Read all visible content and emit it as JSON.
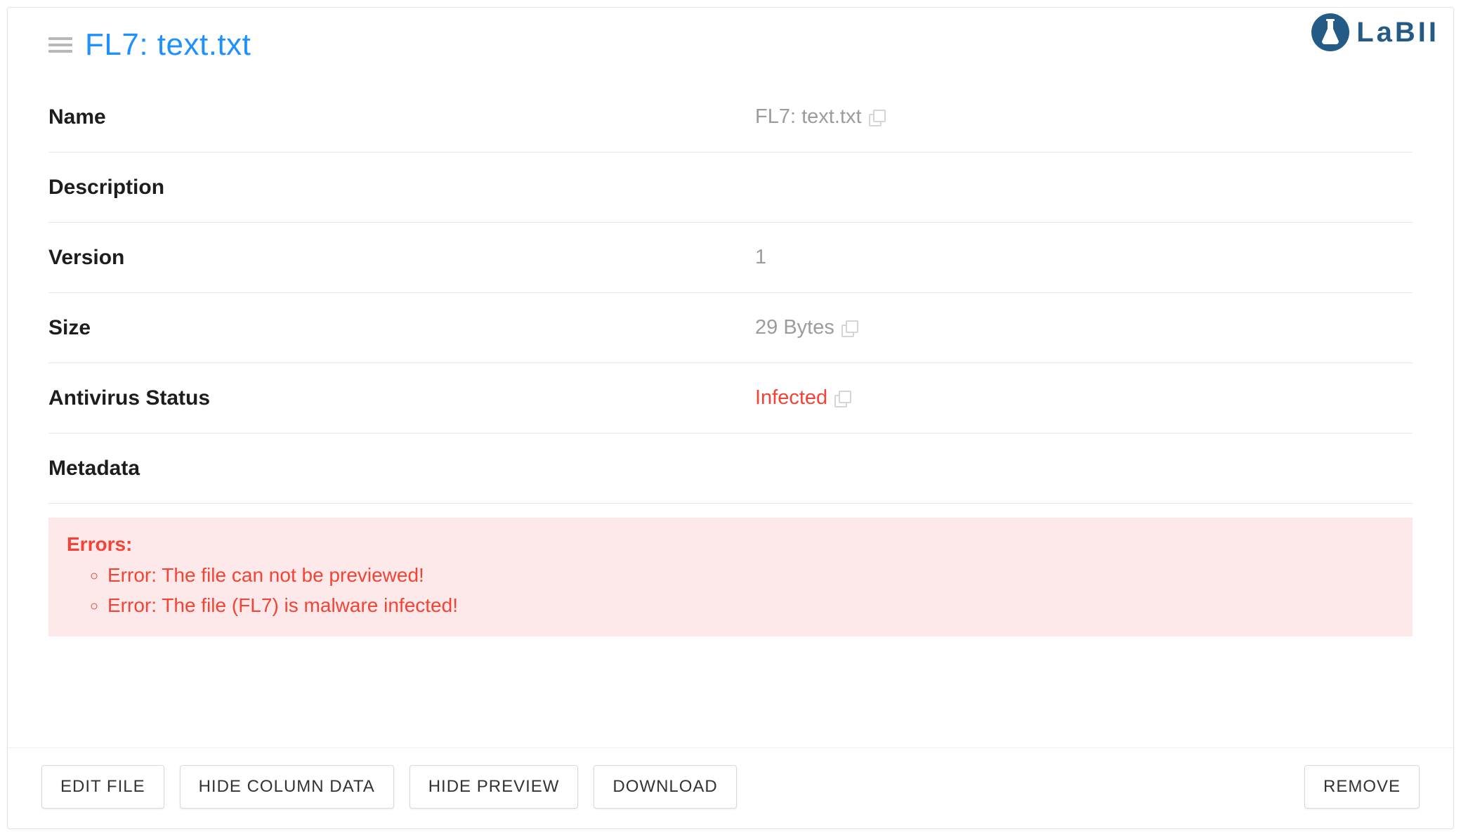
{
  "brand": {
    "name": "LaBII"
  },
  "header": {
    "title": "FL7: text.txt"
  },
  "fields": {
    "name": {
      "label": "Name",
      "value": "FL7: text.txt",
      "copyable": true,
      "danger": false
    },
    "description": {
      "label": "Description",
      "value": "",
      "copyable": false,
      "danger": false
    },
    "version": {
      "label": "Version",
      "value": "1",
      "copyable": false,
      "danger": false
    },
    "size": {
      "label": "Size",
      "value": "29 Bytes",
      "copyable": true,
      "danger": false
    },
    "antivirus": {
      "label": "Antivirus Status",
      "value": "Infected",
      "copyable": true,
      "danger": true
    },
    "metadata": {
      "label": "Metadata",
      "value": "",
      "copyable": false,
      "danger": false
    }
  },
  "errors": {
    "title": "Errors:",
    "items": [
      "Error: The file can not be previewed!",
      "Error: The file (FL7) is malware infected!"
    ]
  },
  "actions": {
    "edit_file": "EDIT FILE",
    "hide_column": "HIDE COLUMN DATA",
    "hide_preview": "HIDE PREVIEW",
    "download": "DOWNLOAD",
    "remove": "REMOVE"
  }
}
